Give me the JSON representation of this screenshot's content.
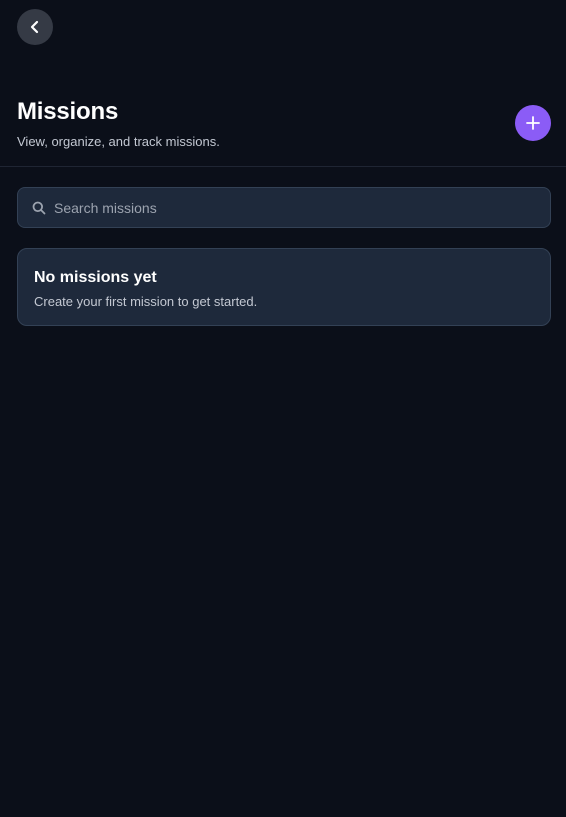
{
  "nav": {
    "back_icon": "chevron-left-icon"
  },
  "header": {
    "title": "Missions",
    "subtitle": "View, organize, and track missions.",
    "add_icon": "plus-icon",
    "accent_color": "#8b5cf6"
  },
  "search": {
    "placeholder": "Search missions",
    "value": "",
    "icon": "search-icon"
  },
  "empty_state": {
    "title": "No missions yet",
    "description": "Create your first mission to get started."
  }
}
